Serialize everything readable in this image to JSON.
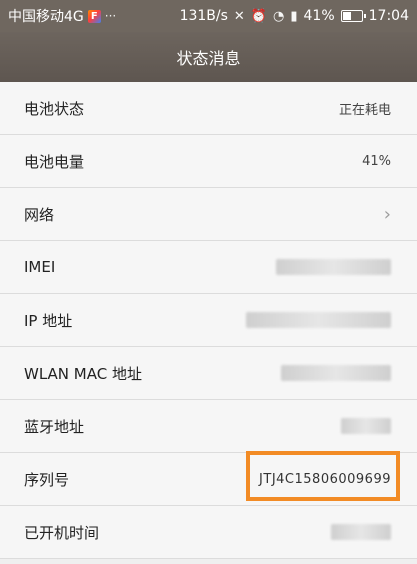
{
  "statusbar": {
    "carrier": "中国移动4G",
    "app_icon_letter": "F",
    "more_dots": "···",
    "net_speed": "131B/s",
    "icons": [
      "mute-icon",
      "alarm-icon",
      "wifi-icon",
      "signal-4g-icon"
    ],
    "battery_percent": "41%",
    "time": "17:04"
  },
  "titlebar": {
    "title": "状态消息"
  },
  "rows": [
    {
      "label": "电池状态",
      "value": "正在耗电"
    },
    {
      "label": "电池电量",
      "value": "41%"
    },
    {
      "label": "网络",
      "value": ""
    },
    {
      "label": "IMEI",
      "value": ""
    },
    {
      "label": "IP 地址",
      "value": ""
    },
    {
      "label": "WLAN MAC 地址",
      "value": ""
    },
    {
      "label": "蓝牙地址",
      "value": ""
    },
    {
      "label": "序列号",
      "value": "JTJ4C15806009699"
    },
    {
      "label": "已开机时间",
      "value": ""
    }
  ],
  "colors": {
    "accent_highlight": "#f28b25",
    "header": "#6d655e"
  }
}
